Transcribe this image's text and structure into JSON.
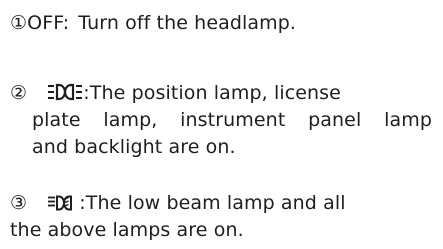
{
  "items": [
    {
      "number": "①",
      "label": "OFF",
      "separator": ":",
      "text": "Turn off the headlamp."
    },
    {
      "number": "②",
      "icon": "position-lamp-icon",
      "separator": ":",
      "line1": "The position lamp, license",
      "line2": "plate lamp, instrument panel lamp",
      "line3": "and backlight are on."
    },
    {
      "number": "③",
      "icon": "low-beam-lamp-icon",
      "separator": ":",
      "line1": "The low beam lamp and all",
      "line2": "the above lamps are on."
    }
  ]
}
